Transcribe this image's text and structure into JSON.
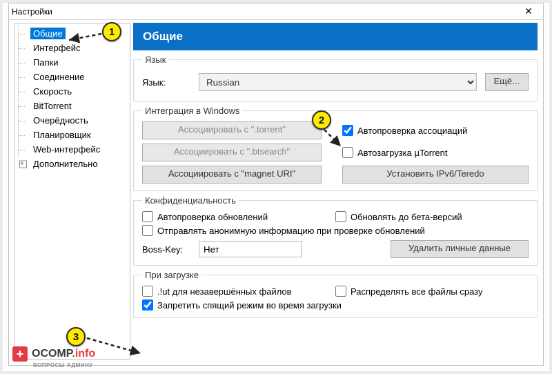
{
  "window": {
    "title": "Настройки",
    "close_glyph": "✕"
  },
  "sidebar": {
    "items": [
      {
        "label": "Общие",
        "selected": true
      },
      {
        "label": "Интерфейс"
      },
      {
        "label": "Папки"
      },
      {
        "label": "Соединение"
      },
      {
        "label": "Скорость"
      },
      {
        "label": "BitTorrent"
      },
      {
        "label": "Очерёдность"
      },
      {
        "label": "Планировщик"
      },
      {
        "label": "Web-интерфейс"
      },
      {
        "label": "Дополнительно",
        "expandable": true
      }
    ]
  },
  "main": {
    "header": "Общие",
    "language": {
      "legend": "Язык",
      "label": "Язык:",
      "value": "Russian",
      "more_button": "Ещё..."
    },
    "integration": {
      "legend": "Интеграция в Windows",
      "assoc_torrent": "Ассоциировать с \".torrent\"",
      "assoc_btsearch": "Ассоциировать с \".btsearch\"",
      "assoc_magnet": "Ассоциировать с \"magnet URI\"",
      "auto_check_assoc": "Автопроверка ассоциаций",
      "autoload_utorrent": "Автозагрузка µTorrent",
      "install_teredo": "Установить IPv6/Teredo"
    },
    "privacy": {
      "legend": "Конфиденциальность",
      "auto_check_updates": "Автопроверка обновлений",
      "update_to_beta": "Обновлять до бета-версий",
      "send_anon": "Отправлять анонимную информацию при проверке обновлений",
      "boss_key_label": "Boss-Key:",
      "boss_key_value": "Нет",
      "delete_personal": "Удалить личные данные"
    },
    "downloading": {
      "legend": "При загрузке",
      "ut_incomplete": ".!ut для незавершённых файлов",
      "allocate_all": "Распределять все файлы сразу",
      "prevent_sleep": "Запретить спящий режим во время загрузки"
    }
  },
  "callouts": {
    "c1": "1",
    "c2": "2",
    "c3": "3"
  },
  "watermark": {
    "brand": "OCOMP",
    "suffix": ".info",
    "plus": "+",
    "sub": "ВОПРОСЫ АДМИНУ"
  }
}
